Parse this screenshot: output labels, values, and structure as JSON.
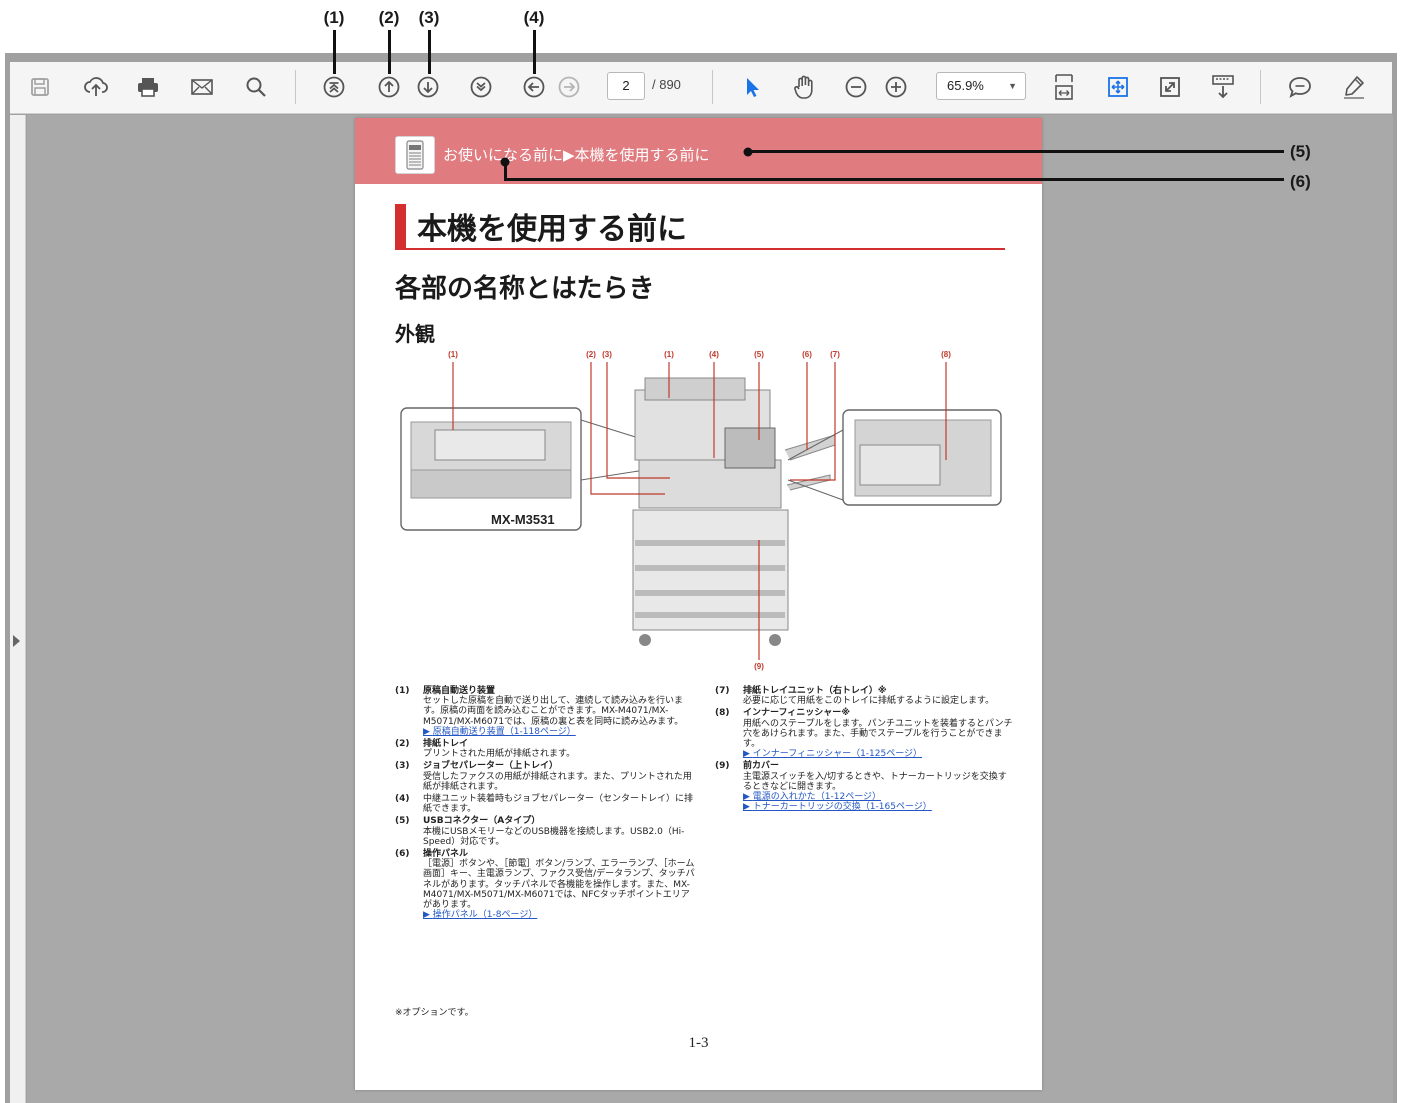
{
  "callouts": {
    "c1": "(1)",
    "c2": "(2)",
    "c3": "(3)",
    "c4": "(4)",
    "c5": "(5)",
    "c6": "(6)"
  },
  "toolbar": {
    "icons": [
      "save-icon",
      "upload-icon",
      "print-icon",
      "mail-icon",
      "search-icon",
      "first-page-icon",
      "previous-page-icon",
      "next-page-icon",
      "last-page-icon",
      "back-view-icon",
      "forward-view-icon",
      "select-cursor-icon",
      "hand-tool-icon",
      "zoom-out-icon",
      "zoom-in-icon",
      "fit-width-icon",
      "fit-page-icon",
      "full-screen-icon",
      "scroll-mode-icon",
      "comment-icon",
      "highlight-icon"
    ],
    "page_current": "2",
    "page_total": "/ 890",
    "zoom": "65.9%",
    "accent": "#1a73e8"
  },
  "doc": {
    "breadcrumb": "お使いになる前に▶本機を使用する前に",
    "h1": "本機を使用する前に",
    "h2": "各部の名称とはたらき",
    "h3": "外観",
    "model": "MX-M3531",
    "figure_numbers": [
      "(1)",
      "(2)",
      "(3)",
      "(1)",
      "(4)",
      "(5)",
      "(6)",
      "(7)",
      "(8)",
      "(9)"
    ],
    "items_left": [
      {
        "num": "(1)",
        "title": "原稿自動送り装置",
        "text": "セットした原稿を自動で送り出して、連続して読み込みを行います。原稿の両面を読み込むことができます。MX-M4071/MX-M5071/MX-M6071では、原稿の裏と表を同時に読み込みます。",
        "link": "原稿自動送り装置（1-118ページ）"
      },
      {
        "num": "(2)",
        "title": "排紙トレイ",
        "text": "プリントされた用紙が排紙されます。",
        "link": ""
      },
      {
        "num": "(3)",
        "title": "ジョブセパレーター（上トレイ）",
        "text": "受信したファクスの用紙が排紙されます。また、プリントされた用紙が排紙されます。",
        "link": ""
      },
      {
        "num": "(4)",
        "title": "",
        "text": "中継ユニット装着時もジョブセパレーター（センタートレイ）に排紙できます。",
        "link": ""
      },
      {
        "num": "(5)",
        "title": "USBコネクター（Aタイプ）",
        "text": "本機にUSBメモリーなどのUSB機器を接続します。USB2.0（Hi-Speed）対応です。",
        "link": ""
      },
      {
        "num": "(6)",
        "title": "操作パネル",
        "text": "［電源］ボタンや、［節電］ボタン/ランプ、エラーランプ、［ホーム画面］キー、主電源ランプ、ファクス受信/データランプ、タッチパネルがあります。タッチパネルで各機能を操作します。また、MX-M4071/MX-M5071/MX-M6071では、NFCタッチポイントエリアがあります。",
        "link": "操作パネル（1-8ページ）"
      }
    ],
    "items_right": [
      {
        "num": "(7)",
        "title": "排紙トレイユニット（右トレイ）※",
        "text": "必要に応じて用紙をこのトレイに排紙するように設定します。",
        "link": ""
      },
      {
        "num": "(8)",
        "title": "インナーフィニッシャー※",
        "text": "用紙へのステープルをします。パンチユニットを装着するとパンチ穴をあけられます。また、手動でステープルを行うことができます。",
        "link": "インナーフィニッシャー（1-125ページ）"
      },
      {
        "num": "(9)",
        "title": "前カバー",
        "text": "主電源スイッチを入/切するときや、トナーカートリッジを交換するときなどに開きます。",
        "link": "電源の入れかた（1-12ページ）",
        "link2": "トナーカートリッジの交換（1-165ページ）"
      }
    ],
    "note": "※オプションです。",
    "page_number": "1-3"
  }
}
